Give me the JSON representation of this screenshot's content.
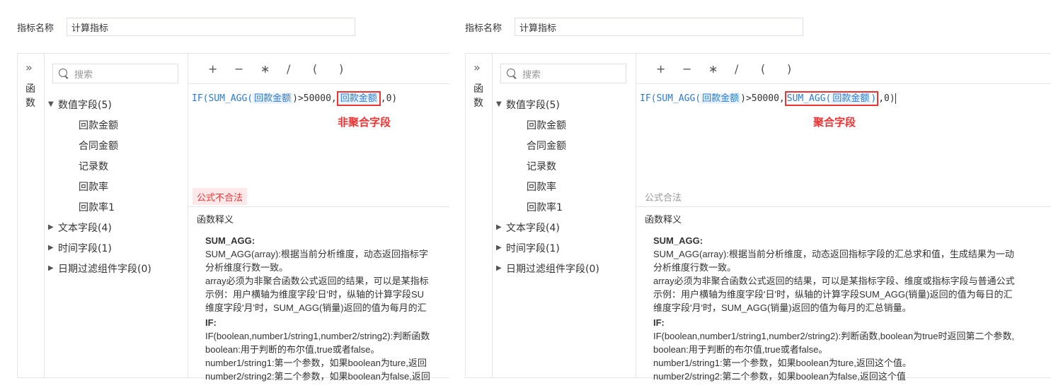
{
  "panels": [
    {
      "name_label": "指标名称",
      "name_value": "计算指标",
      "fn_label": [
        "函",
        "数"
      ],
      "search_placeholder": "搜索",
      "groups": [
        {
          "label": "数值字段(5)",
          "expanded": true,
          "items": [
            "回款金额",
            "合同金额",
            "记录数",
            "回款率",
            "回款率1"
          ]
        },
        {
          "label": "文本字段(4)",
          "expanded": false,
          "items": []
        },
        {
          "label": "时间字段(1)",
          "expanded": false,
          "items": []
        },
        {
          "label": "日期过滤组件字段(0)",
          "expanded": false,
          "items": []
        }
      ],
      "operators": [
        "+",
        "−",
        "∗",
        "/",
        "(",
        ")"
      ],
      "formula": {
        "p1": "IF(",
        "f1": "SUM_AGG(",
        "field1": "回款金额",
        "p2": ")>50000,",
        "field2_prefix": "",
        "field2": "回款金额",
        "field2_suffix": "",
        "p3": ",0)"
      },
      "annotation": "非聚合字段",
      "status": "公式不合法",
      "explain_title": "函数释义",
      "explain": {
        "h1": "SUM_AGG:",
        "l1": "SUM_AGG(array):根据当前分析维度，动态返回指标字",
        "l2": "分析维度行数一致。",
        "l3": " array必须为非聚合函数公式返回的结果，可以是某指标",
        "l4": " 示例：用户横轴为维度字段'日'时，纵轴的计算字段SU",
        "l5": "维度字段'月'时，SUM_AGG(销量)返回的值为每月的汇",
        "h2": "IF:",
        "l6": "IF(boolean,number1/string1,number2/string2):判断函数",
        "l7": "boolean:用于判断的布尔值,true或者false。",
        "l8": "number1/string1:第一个参数，如果boolean为ture,返回",
        "l9": "number2/string2:第二个参数，如果boolean为false,返回"
      }
    },
    {
      "name_label": "指标名称",
      "name_value": "计算指标",
      "fn_label": [
        "函",
        "数"
      ],
      "search_placeholder": "搜索",
      "groups": [
        {
          "label": "数值字段(5)",
          "expanded": true,
          "items": [
            "回款金额",
            "合同金额",
            "记录数",
            "回款率",
            "回款率1"
          ]
        },
        {
          "label": "文本字段(4)",
          "expanded": false,
          "items": []
        },
        {
          "label": "时间字段(1)",
          "expanded": false,
          "items": []
        },
        {
          "label": "日期过滤组件字段(0)",
          "expanded": false,
          "items": []
        }
      ],
      "operators": [
        "+",
        "−",
        "∗",
        "/",
        "(",
        ")"
      ],
      "formula": {
        "p1": "IF(",
        "f1": "SUM_AGG(",
        "field1": "回款金额",
        "p2": ")>50000,",
        "field2_prefix": "SUM_AGG(",
        "field2": "回款金额",
        "field2_suffix": ")",
        "p3": ",0)"
      },
      "annotation": "聚合字段",
      "status": "公式合法",
      "explain_title": "函数释义",
      "explain": {
        "h1": "SUM_AGG:",
        "l1": "SUM_AGG(array):根据当前分析维度，动态返回指标字段的汇总求和值，生成结果为一动",
        "l2": "分析维度行数一致。",
        "l3": " array必须为非聚合函数公式返回的结果，可以是某指标字段、维度或指标字段与普通公式",
        "l4": " 示例：用户横轴为维度字段'日'时，纵轴的计算字段SUM_AGG(销量)返回的值为每日的汇",
        "l5": "维度字段'月'时，SUM_AGG(销量)返回的值为每月的汇总销量。",
        "h2": "IF:",
        "l6": "IF(boolean,number1/string1,number2/string2):判断函数,boolean为true时返回第二个参数,",
        "l7": "boolean:用于判断的布尔值,true或者false。",
        "l8": "number1/string1:第一个参数，如果boolean为ture,返回这个值。",
        "l9": "number2/string2:第二个参数，如果boolean为false,返回这个值"
      }
    }
  ],
  "colors": {
    "accent": "#2b7bd6",
    "error": "#e33",
    "border": "#e3e5ea"
  }
}
